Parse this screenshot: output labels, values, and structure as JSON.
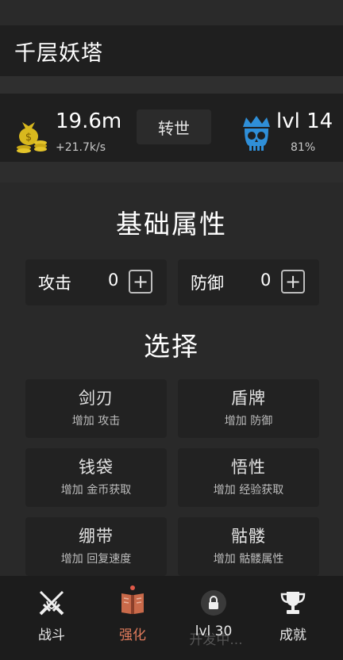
{
  "header": {
    "title": "千层妖塔"
  },
  "stats": {
    "gold": "19.6m",
    "gold_rate": "+21.7k/s",
    "rebirth_label": "转世",
    "level": "lvl 14",
    "level_progress": "81%"
  },
  "basic": {
    "heading": "基础属性",
    "attack": {
      "label": "攻击",
      "value": "0",
      "plus": "+"
    },
    "defense": {
      "label": "防御",
      "value": "0",
      "plus": "+"
    }
  },
  "choose": {
    "heading": "选择",
    "options": [
      {
        "name": "剑刃",
        "desc": "增加 攻击"
      },
      {
        "name": "盾牌",
        "desc": "增加 防御"
      },
      {
        "name": "钱袋",
        "desc": "增加 金币获取"
      },
      {
        "name": "悟性",
        "desc": "增加 经验获取"
      },
      {
        "name": "绷带",
        "desc": "增加 回复速度"
      },
      {
        "name": "骷髅",
        "desc": "增加 骷髅属性"
      }
    ]
  },
  "nav": {
    "battle": "战斗",
    "upgrade": "强化",
    "locked_ghost": "开发中...",
    "locked_req": "lvl 30",
    "achievements": "成就"
  },
  "colors": {
    "gold": "#d8b81e",
    "skull": "#2f8fd8",
    "accent": "#e07b5c"
  },
  "icons": [
    "money-bag-icon",
    "skull-crown-icon",
    "crossed-swords-icon",
    "book-icon",
    "lock-icon",
    "trophy-icon"
  ]
}
